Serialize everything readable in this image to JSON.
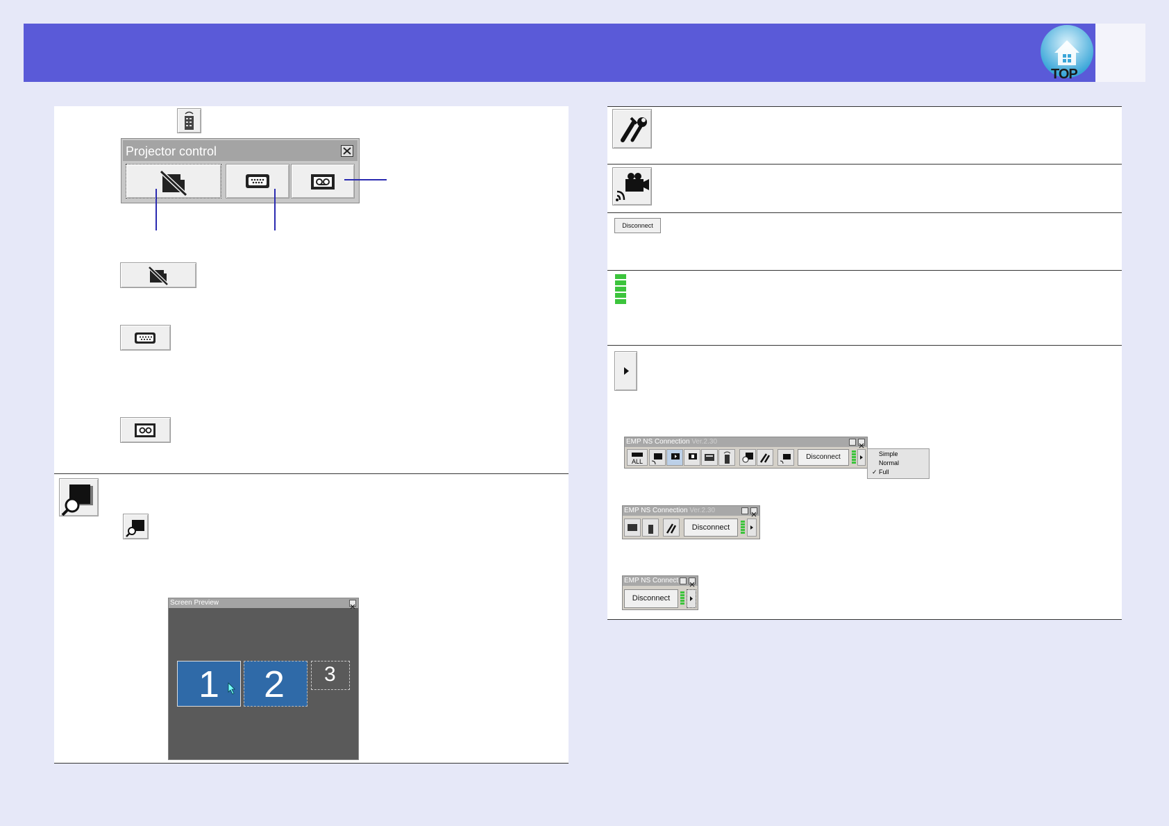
{
  "header": {
    "logo_label": "TOP"
  },
  "projector_control": {
    "title": "Projector control",
    "buttons": [
      "a-v-mute",
      "source-computer",
      "source-video"
    ]
  },
  "screen_preview": {
    "title": "Screen Preview",
    "slots": [
      "1",
      "2",
      "3"
    ]
  },
  "disconnect_label": "Disconnect",
  "connection_windows": {
    "title": "EMP NS Connection",
    "version": "Ver.2.30",
    "title_short": "EMP NS Connect",
    "all_label": "ALL",
    "disconnect": "Disconnect"
  },
  "display_menu": {
    "options": [
      "Simple",
      "Normal",
      "Full"
    ],
    "selected": "Full",
    "check": "✓"
  },
  "colors": {
    "header": "#5a5ad8",
    "accent": "#2a2ab0",
    "meter": "#3cc43c",
    "preview_bg": "#5a5a5a",
    "preview_tile": "#2f6aa8"
  }
}
